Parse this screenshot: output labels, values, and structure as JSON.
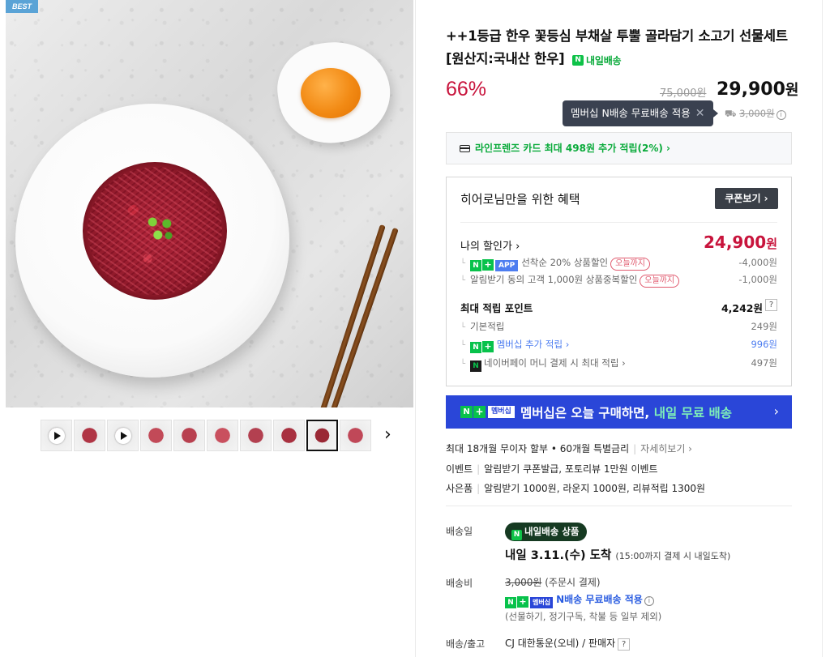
{
  "image": {
    "badge": "BEST"
  },
  "thumbnails": [
    {
      "kind": "video",
      "color": "#8a2a35"
    },
    {
      "kind": "photo",
      "color": "#b03545"
    },
    {
      "kind": "video",
      "color": "#9c3040"
    },
    {
      "kind": "photo",
      "color": "#c24a58"
    },
    {
      "kind": "photo",
      "color": "#b8404f"
    },
    {
      "kind": "photo",
      "color": "#c9505e"
    },
    {
      "kind": "photo",
      "color": "#b34050"
    },
    {
      "kind": "photo",
      "color": "#a8303f"
    },
    {
      "kind": "photo",
      "color": "#9a2835",
      "active": true
    },
    {
      "kind": "photo",
      "color": "#c04858"
    }
  ],
  "product": {
    "title": "++1등급 한우 꽃등심 부채살 투뿔 골라담기 소고기 선물세트 [원산지:국내산 한우]",
    "delivery_badge": "내일배송",
    "discount": "66%",
    "original_price": "75,000원",
    "sale_price_number": "29,900",
    "sale_price_unit": "원"
  },
  "tooltip": {
    "text": "멤버십 N배송 무료배송 적용",
    "close": "✕"
  },
  "shipping_fee_old": {
    "prefix": "",
    "value": "3,000원",
    "info": "i"
  },
  "card_promo": {
    "text": "라인프렌즈 카드 최대 498원 추가 적립(2%) ›"
  },
  "benefit": {
    "heading": "히어로님만을 위한 혜택",
    "coupon_button": "쿠폰보기 ›",
    "my_discount_label": "나의 할인가 ›",
    "my_discount_number": "24,900",
    "my_discount_unit": "원",
    "discounts": [
      {
        "label": "선착순 20% 상품할인",
        "tag": "오늘까지",
        "amount": "-4,000원"
      },
      {
        "label": "알림받기 동의 고객 1,000원 상품중복할인",
        "tag": "오늘까지",
        "amount": "-1,000원"
      }
    ],
    "points_label": "최대 적립 포인트",
    "points_value": "4,242원",
    "points_help": "?",
    "point_rows": [
      {
        "label": "기본적립",
        "amount": "249원"
      },
      {
        "label": "멤버십 추가 적립 ›",
        "amount": "996원"
      },
      {
        "label": "네이버페이 머니 결제 시 최대 적립 ›",
        "amount": "497원"
      }
    ],
    "tag_app": "APP",
    "tag_n": "N",
    "tag_plus": "+"
  },
  "membership_banner": {
    "membership_tag": "멤버십",
    "text_before": "멤버십은 오늘 구매하면, ",
    "text_highlight": "내일 무료 배송",
    "chevron": "›"
  },
  "info_lines": [
    {
      "main": "최대 18개월 무이자 할부 • 60개월 특별금리",
      "more": "자세히보기 ›"
    },
    {
      "label": "이벤트",
      "text": "알림받기 쿠폰발급, 포토리뷰 1만원 이벤트"
    },
    {
      "label": "사은품",
      "text": "알림받기 1000원, 라운지 1000원, 리뷰적립 1300원"
    }
  ],
  "delivery": {
    "date_label": "배송일",
    "pill": "내일배송 상품",
    "arrive_main": "내일 3.11.(수) 도착",
    "arrive_note": "(15:00까지 결제 시 내일도착)",
    "fee_label": "배송비",
    "fee_value": "3,000원",
    "fee_note": "(주문시 결제)",
    "nfree_tag": "멤버십",
    "nfree_text": "N배송 무료배송 적용",
    "nfree_info": "i",
    "fee_exclusion": "(선물하기, 정기구독, 착불 등 일부 제외)",
    "courier_label": "배송/출고",
    "courier_value": "CJ 대한통운(오네) / 판매자",
    "courier_help": "?"
  },
  "colors": {
    "accent_red": "#c8143c",
    "naver_green": "#08c24b",
    "banner_blue": "#2a46d8",
    "link_blue": "#4d7df0"
  }
}
